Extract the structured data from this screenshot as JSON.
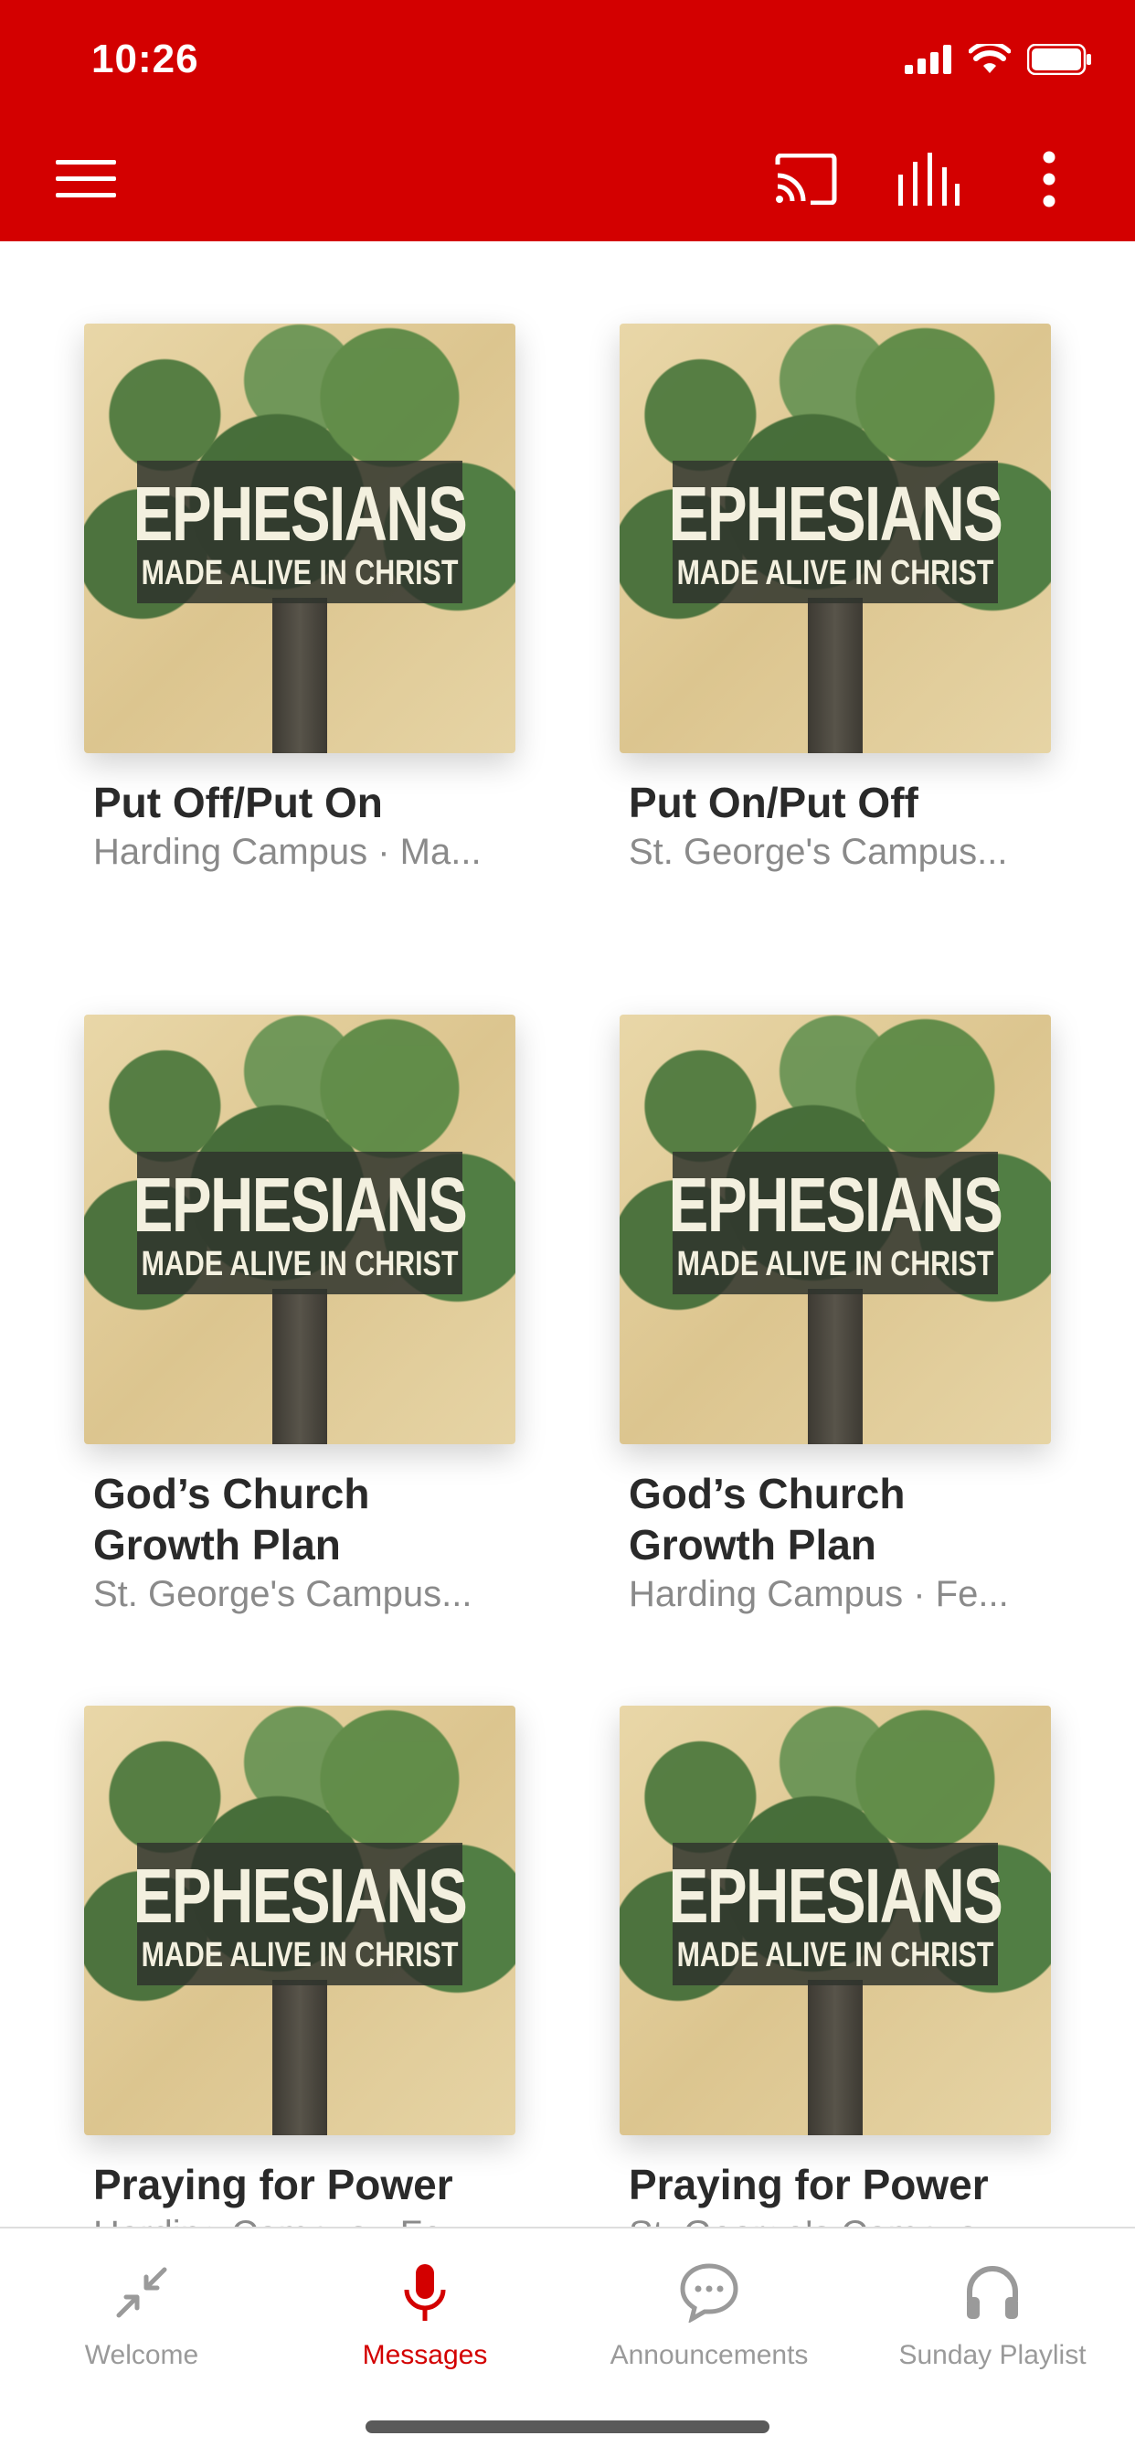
{
  "status_bar": {
    "time": "10:26"
  },
  "toolbar": {
    "menu_icon": "hamburger-menu-icon",
    "actions": [
      "cast-icon",
      "equalizer-icon",
      "more-vertical-icon"
    ]
  },
  "colors": {
    "brand": "#d30000",
    "text": "#2a2a2a",
    "subtext": "#8a8a8a"
  },
  "messages": [
    {
      "title": "Put Off/Put On",
      "subtitle": "Harding Campus · Ma...",
      "art_title": "EPHESIANS",
      "art_subtitle": "MADE ALIVE IN CHRIST"
    },
    {
      "title": "Put On/Put Off",
      "subtitle": "St. George's Campus...",
      "art_title": "EPHESIANS",
      "art_subtitle": "MADE ALIVE IN CHRIST"
    },
    {
      "title": "God’s Church Growth Plan",
      "subtitle": "St. George's Campus...",
      "art_title": "EPHESIANS",
      "art_subtitle": "MADE ALIVE IN CHRIST"
    },
    {
      "title": "God’s Church Growth Plan",
      "subtitle": "Harding Campus · Fe...",
      "art_title": "EPHESIANS",
      "art_subtitle": "MADE ALIVE IN CHRIST"
    },
    {
      "title": "Praying for Power",
      "subtitle": "Harding Campus · Fe...",
      "art_title": "EPHESIANS",
      "art_subtitle": "MADE ALIVE IN CHRIST"
    },
    {
      "title": "Praying for Power",
      "subtitle": "St. George's Campus...",
      "art_title": "EPHESIANS",
      "art_subtitle": "MADE ALIVE IN CHRIST"
    }
  ],
  "tabs": [
    {
      "label": "Welcome",
      "icon": "compress-arrows-icon",
      "active": false
    },
    {
      "label": "Messages",
      "icon": "microphone-icon",
      "active": true
    },
    {
      "label": "Announcements",
      "icon": "chat-bubble-icon",
      "active": false
    },
    {
      "label": "Sunday Playlist",
      "icon": "headphones-icon",
      "active": false
    }
  ]
}
